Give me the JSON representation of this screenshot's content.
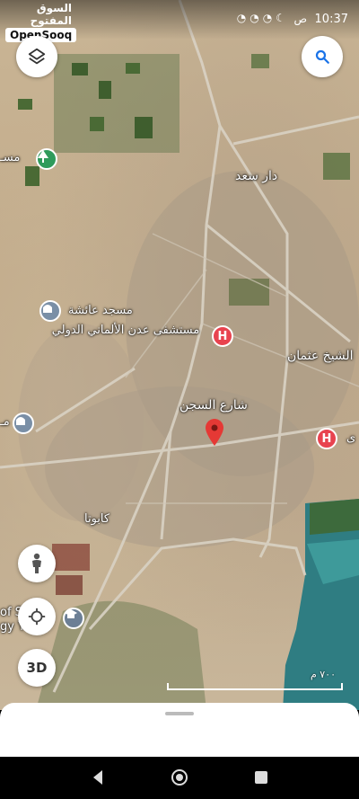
{
  "status_bar": {
    "time": "10:37",
    "ampm": "ص",
    "icons": [
      "moon-icon",
      "whatsapp-icon",
      "whatsapp-icon",
      "whatsapp-icon"
    ]
  },
  "brand": {
    "arabic": "السوق المفتوح",
    "english": "OpenSooq"
  },
  "map": {
    "labels": {
      "dar_saad": "دار سعد",
      "aisha_mosque": "مسجد عائشة",
      "hospital": "مستشفى عدن الألماني الدولي",
      "sheikh_othman": "الشيخ عثمان",
      "sijn_street": "شارع السجن",
      "kabota": "كابوتا",
      "left_cut_top": "مسـ",
      "left_cut_mid": "مـ",
      "left_cut_bottom1": "of S",
      "left_cut_bottom2": "gy Y",
      "right_cut": "ى"
    },
    "scale_label": "٧٠٠ م"
  },
  "buttons": {
    "layers": "layers-icon",
    "search": "search-icon",
    "streetview": "pegman-icon",
    "location": "my-location-icon",
    "threed": "3D"
  },
  "colors": {
    "hospital": "#e8434f",
    "pin": "#e53935",
    "search_blue": "#1a73e8",
    "water": "#3a8a8a"
  }
}
